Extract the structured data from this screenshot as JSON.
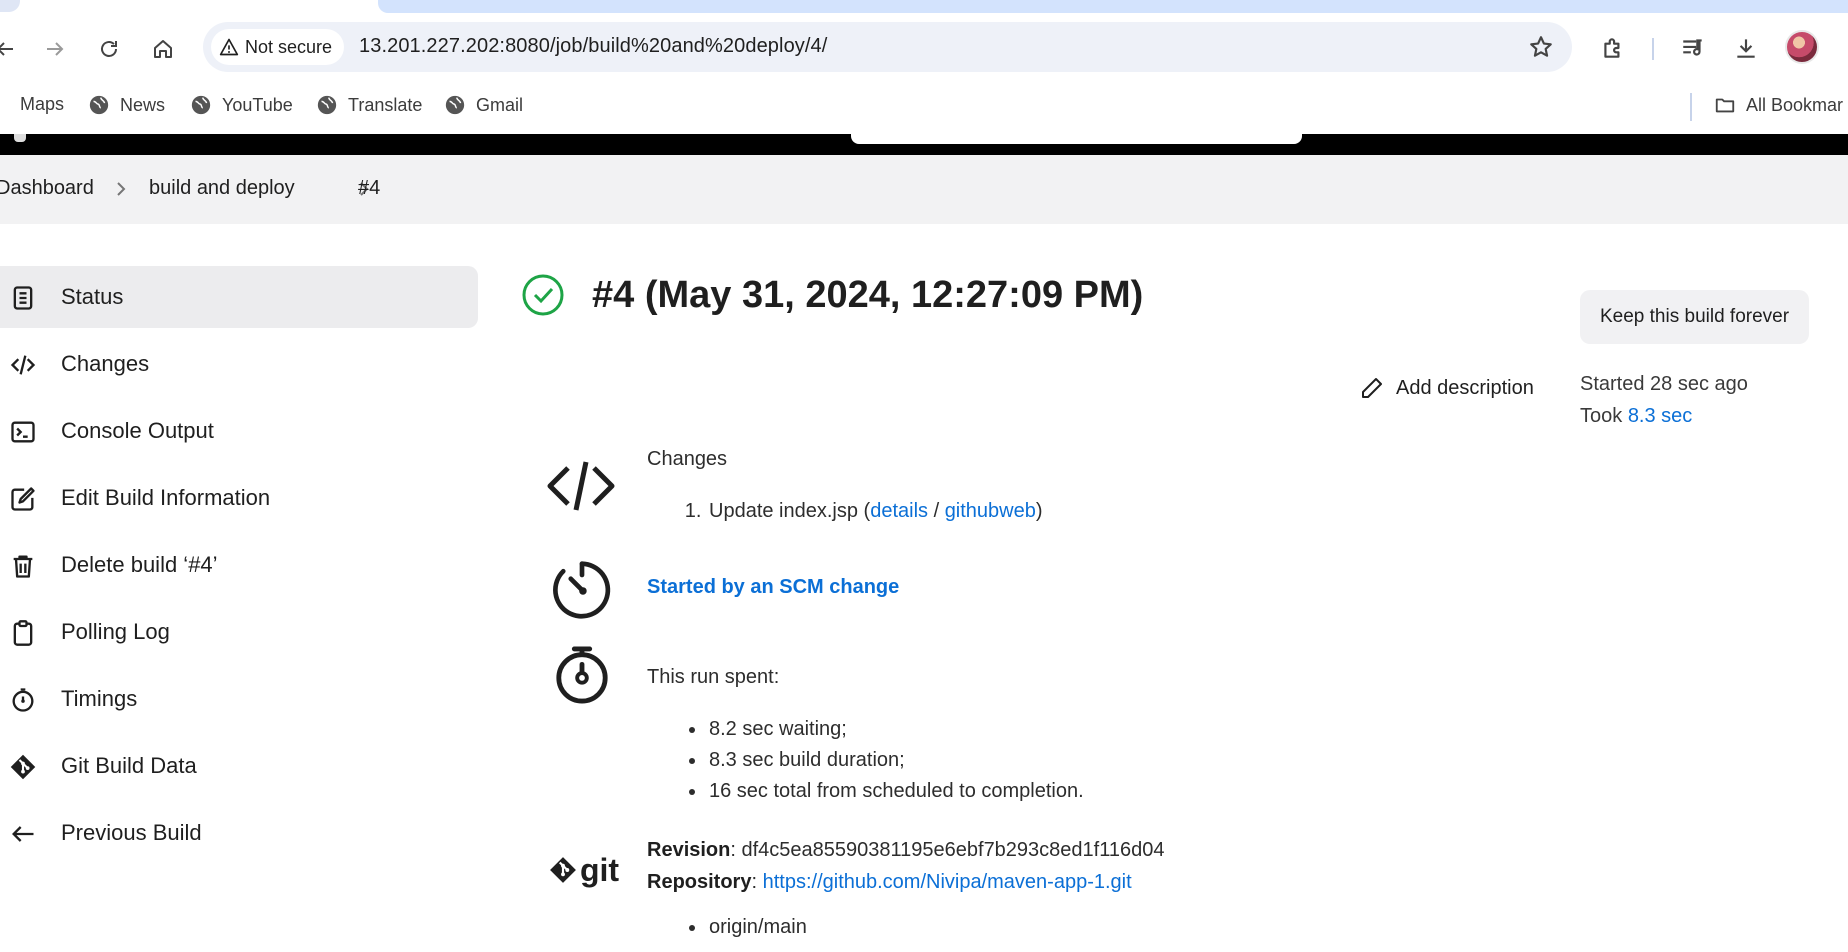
{
  "browser": {
    "security_label": "Not secure",
    "url": "13.201.227.202:8080/job/build%20and%20deploy/4/",
    "bookmarks": [
      {
        "label": "Maps",
        "icon": "maps-icon"
      },
      {
        "label": "News",
        "icon": "globe-icon"
      },
      {
        "label": "YouTube",
        "icon": "globe-icon"
      },
      {
        "label": "Translate",
        "icon": "globe-icon"
      },
      {
        "label": "Gmail",
        "icon": "globe-icon"
      }
    ],
    "all_bookmarks_label": "All Bookmar"
  },
  "breadcrumbs": [
    "Dashboard",
    "build and deploy",
    "#4"
  ],
  "sidebar": {
    "items": [
      {
        "label": "Status",
        "icon": "notepad-icon",
        "active": true
      },
      {
        "label": "Changes",
        "icon": "code-icon",
        "active": false
      },
      {
        "label": "Console Output",
        "icon": "terminal-icon",
        "active": false
      },
      {
        "label": "Edit Build Information",
        "icon": "edit-icon",
        "active": false
      },
      {
        "label": "Delete build ‘#4’",
        "icon": "trash-icon",
        "active": false
      },
      {
        "label": "Polling Log",
        "icon": "clipboard-icon",
        "active": false
      },
      {
        "label": "Timings",
        "icon": "stopwatch-icon",
        "active": false
      },
      {
        "label": "Git Build Data",
        "icon": "git-icon",
        "active": false
      },
      {
        "label": "Previous Build",
        "icon": "arrow-left-icon",
        "active": false
      }
    ]
  },
  "build": {
    "title": "#4 (May 31, 2024, 12:27:09 PM)",
    "keep_label": "Keep this build forever",
    "add_description_label": "Add description",
    "started_label": "Started 28 sec ago",
    "took_prefix": "Took ",
    "took_value": "8.3 sec",
    "status_color": "#1ea446"
  },
  "changes": {
    "heading": "Changes",
    "item_text": "Update index.jsp (",
    "details_link": "details",
    "separator": " / ",
    "githubweb_link": "githubweb",
    "close": ")"
  },
  "cause": {
    "label": "Started by an SCM change"
  },
  "timing": {
    "heading": "This run spent:",
    "items": [
      "8.2 sec waiting;",
      "8.3 sec build duration;",
      "16 sec total from scheduled to completion."
    ]
  },
  "git": {
    "logo_text": "git",
    "revision_label": "Revision",
    "revision_value": ": df4c5ea85590381195e6ebf7b293c8ed1f116d04",
    "repository_label": "Repository",
    "repository_sep": ": ",
    "repository_url": "https://github.com/Nivipa/maven-app-1.git",
    "branches": [
      "origin/main"
    ]
  },
  "colors": {
    "link": "#0b6fd6",
    "header_bg": "#000000",
    "breadcrumb_bg": "#f2f2f3"
  }
}
